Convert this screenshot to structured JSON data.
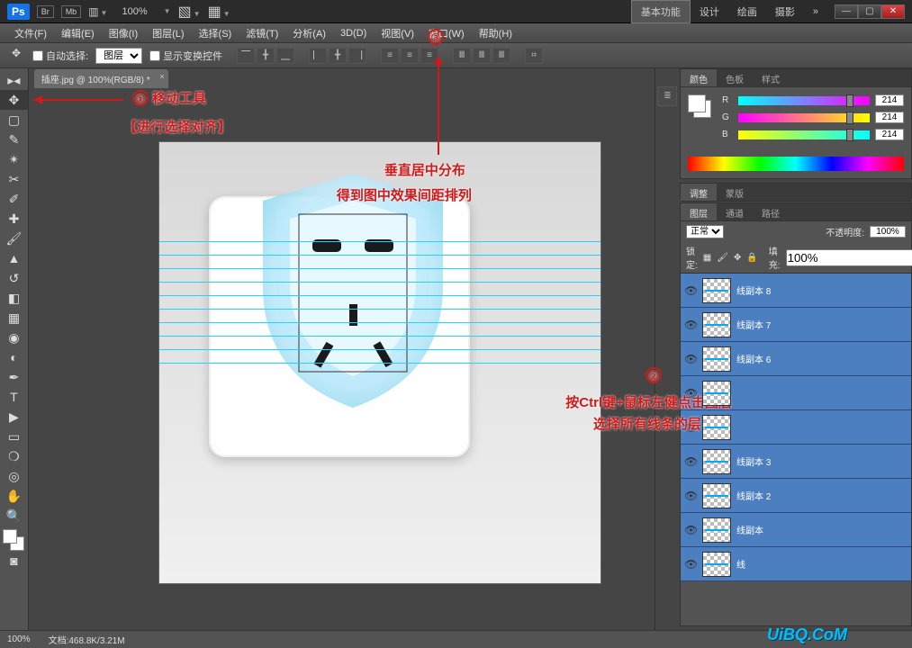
{
  "topbar": {
    "logo": "Ps",
    "boxes": [
      "Br",
      "Mb"
    ],
    "zoom": "100%",
    "workspaces": [
      "基本功能",
      "设计",
      "绘画",
      "摄影",
      "»"
    ],
    "active_ws": 0
  },
  "menus": [
    "文件(F)",
    "编辑(E)",
    "图像(I)",
    "图层(L)",
    "选择(S)",
    "滤镜(T)",
    "分析(A)",
    "3D(D)",
    "视图(V)",
    "窗口(W)",
    "帮助(H)"
  ],
  "options": {
    "auto_select": "自动选择:",
    "select_target": "图层",
    "show_transform": "显示变换控件"
  },
  "doc_tab": "插座.jpg @ 100%(RGB/8) *",
  "annotations": {
    "step1_num": "①",
    "step1": "移动工具",
    "step1_sub": "【进行选择对齐】",
    "step2_num": "②",
    "step2a": "按Ctrl键+鼠标左健点击图层",
    "step2b": "选择所有线条的层",
    "step3_num": "③",
    "step3a": "垂直居中分布",
    "step3b": "得到图中效果间距排列"
  },
  "color_panel": {
    "tabs": [
      "颜色",
      "色板",
      "样式"
    ],
    "r_label": "R",
    "r_val": "214",
    "g_label": "G",
    "g_val": "214",
    "b_label": "B",
    "b_val": "214"
  },
  "adjust_panel": {
    "tabs": [
      "调整",
      "蒙版"
    ]
  },
  "layers_panel": {
    "tabs": [
      "图层",
      "通道",
      "路径"
    ],
    "blend": "正常",
    "opacity_label": "不透明度:",
    "opacity_val": "100%",
    "lock_label": "锁定:",
    "fill_label": "填充:",
    "fill_val": "100%",
    "layers": [
      "线副本 8",
      "线副本 7",
      "线副本 6",
      "",
      "",
      "线副本 3",
      "线副本 2",
      "线副本",
      "线"
    ]
  },
  "statusbar": {
    "zoom": "100%",
    "doc": "文档:468.8K/3.21M"
  },
  "watermark": "UiBQ.CoM"
}
